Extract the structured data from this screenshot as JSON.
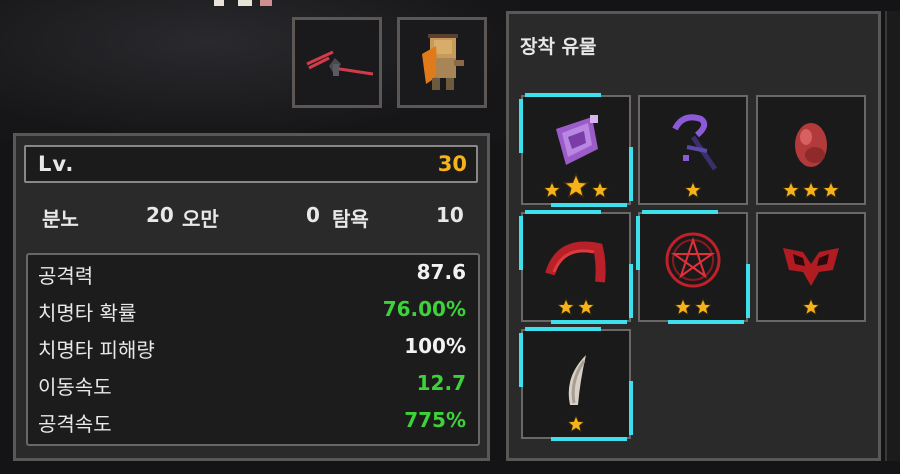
{
  "level": {
    "label": "Lv.",
    "value": "30"
  },
  "traits": [
    {
      "name": "분노",
      "value": "20"
    },
    {
      "name": "오만",
      "value": "0"
    },
    {
      "name": "탐욕",
      "value": "10"
    }
  ],
  "stats": [
    {
      "name": "공격력",
      "value": "87.6",
      "color": "#f2f2f2"
    },
    {
      "name": "치명타 확률",
      "value": "76.00%",
      "color": "#3ed23a"
    },
    {
      "name": "치명타 피해량",
      "value": "100%",
      "color": "#f2f2f2"
    },
    {
      "name": "이동속도",
      "value": "12.7",
      "color": "#3ed23a"
    },
    {
      "name": "공격속도",
      "value": "775%",
      "color": "#3ed23a"
    }
  ],
  "equipment": {
    "weapon_icon": "red-spear-icon",
    "pet_icon": "scarecrow-doll-icon"
  },
  "relics": {
    "title": "장착 유물",
    "items": [
      {
        "icon": "purple-cloth-icon",
        "stars": 3,
        "highlight": true
      },
      {
        "icon": "purple-scythe-icon",
        "stars": 1,
        "highlight": false
      },
      {
        "icon": "red-egg-icon",
        "stars": 3,
        "highlight": false
      },
      {
        "icon": "red-claw-icon",
        "stars": 2,
        "highlight": true
      },
      {
        "icon": "pentagram-icon",
        "stars": 2,
        "highlight": true
      },
      {
        "icon": "demon-wing-icon",
        "stars": 1,
        "highlight": false
      },
      {
        "icon": "bone-fang-icon",
        "stars": 1,
        "highlight": true
      }
    ]
  },
  "colors": {
    "level": "#f6b21a",
    "accent": "#3ee0ee",
    "bonus": "#3ed23a",
    "star": "#f6b21a"
  }
}
